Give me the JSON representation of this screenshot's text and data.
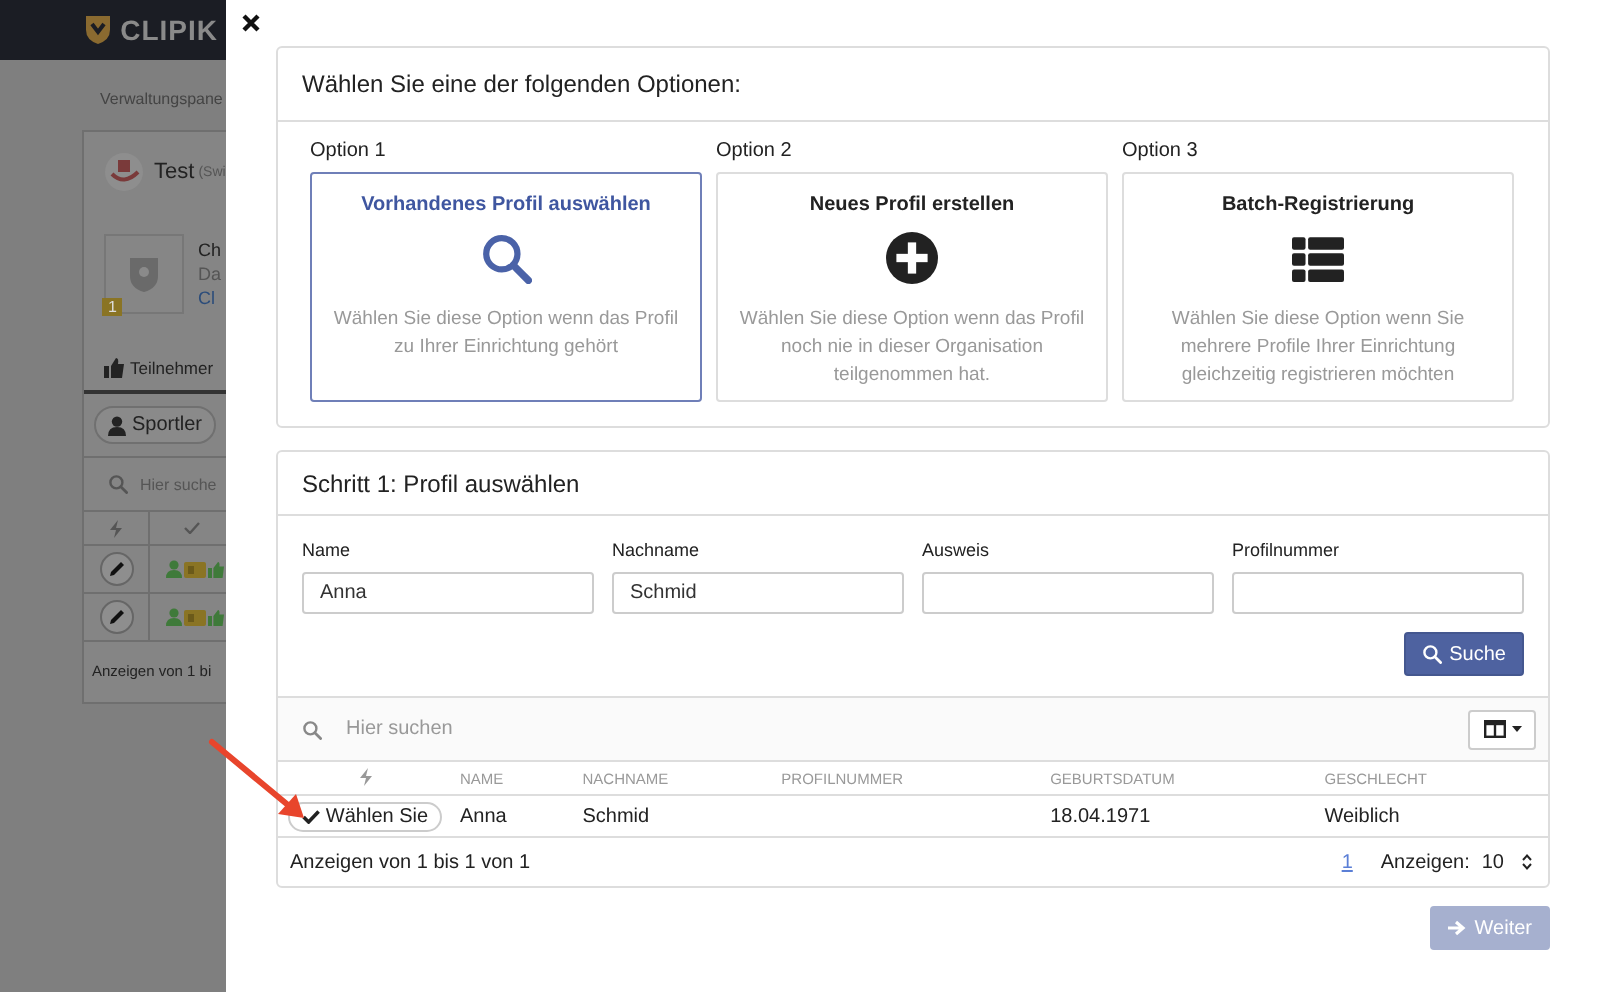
{
  "background_page": {
    "brand": "CLIPIK",
    "breadcrumb": "Verwaltungspane",
    "club": {
      "name": "Test",
      "suffix": "(Swi"
    },
    "event": {
      "lines": [
        "Ch",
        "Da",
        "Cl"
      ],
      "badge": "1"
    },
    "tab": "Teilnehmer",
    "filter": "Sportler",
    "search_placeholder": "Hier suche",
    "rows": [
      {
        "kind": "participant"
      },
      {
        "kind": "participant"
      }
    ],
    "footer": "Anzeigen von 1 bi"
  },
  "modal": {
    "options_title": "Wählen Sie eine der folgenden Optionen:",
    "options": [
      {
        "label": "Option 1",
        "title": "Vorhandenes Profil auswählen",
        "kind": "search",
        "description": "Wählen Sie diese Option wenn das Profil zu Ihrer Einrichtung gehört",
        "selected": true
      },
      {
        "label": "Option 2",
        "title": "Neues Profil erstellen",
        "kind": "plus",
        "description": "Wählen Sie diese Option wenn das Profil noch nie in dieser Organisation teilgenommen hat.",
        "selected": false
      },
      {
        "label": "Option 3",
        "title": "Batch-Registrierung",
        "kind": "list",
        "description": "Wählen Sie diese Option wenn Sie mehrere Profile Ihrer Einrichtung gleichzeitig registrieren möchten",
        "selected": false
      }
    ],
    "step": {
      "title": "Schritt 1: Profil auswählen",
      "fields": [
        {
          "label": "Name",
          "value": "Anna"
        },
        {
          "label": "Nachname",
          "value": "Schmid"
        },
        {
          "label": "Ausweis"
        },
        {
          "label": "Profilnummer"
        }
      ],
      "search_button": "Suche"
    },
    "results": {
      "search_placeholder": "Hier suchen",
      "columns": [
        {
          "kind": "icon"
        },
        {
          "kind": "text",
          "label": "NAME"
        },
        {
          "kind": "text",
          "label": "NACHNAME"
        },
        {
          "kind": "text",
          "label": "PROFILNUMMER"
        },
        {
          "kind": "text",
          "label": "GEBURTSDATUM"
        },
        {
          "kind": "text",
          "label": "GESCHLECHT"
        }
      ],
      "rows": [
        {
          "cells": [
            "Wählen Sie",
            "Anna",
            "Schmid",
            "",
            "18.04.1971",
            "Weiblich"
          ]
        }
      ],
      "footer": {
        "summary": "Anzeigen von 1 bis 1 von 1",
        "page": "1",
        "page_size_label": "Anzeigen:",
        "page_size": "10"
      }
    },
    "next_button": {
      "label": "Weiter",
      "disabled": true
    }
  }
}
